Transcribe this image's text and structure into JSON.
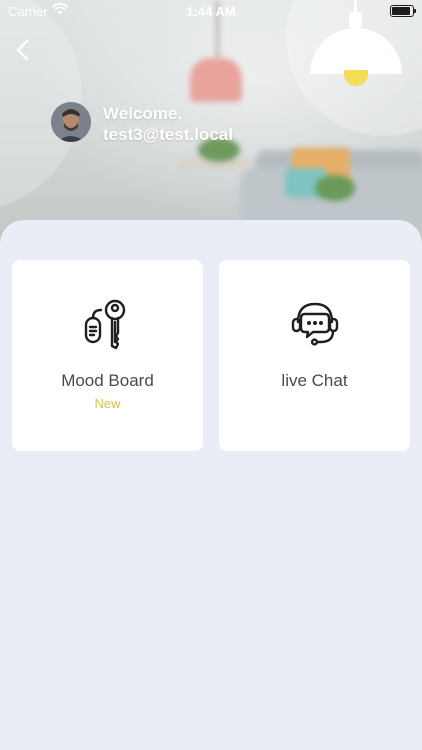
{
  "status_bar": {
    "carrier": "Carrier",
    "time": "1:44 AM"
  },
  "header": {
    "welcome_line1": "Welcome,",
    "welcome_line2": "test3@test.local"
  },
  "cards": [
    {
      "title": "Mood Board",
      "badge": "New",
      "icon": "keys-icon"
    },
    {
      "title": "live Chat",
      "badge": "",
      "icon": "headset-chat-icon"
    }
  ],
  "colors": {
    "background": "#e9edf5",
    "card": "#ffffff",
    "badge": "#d6c24a",
    "lamp_bulb": "#f6dd57"
  }
}
